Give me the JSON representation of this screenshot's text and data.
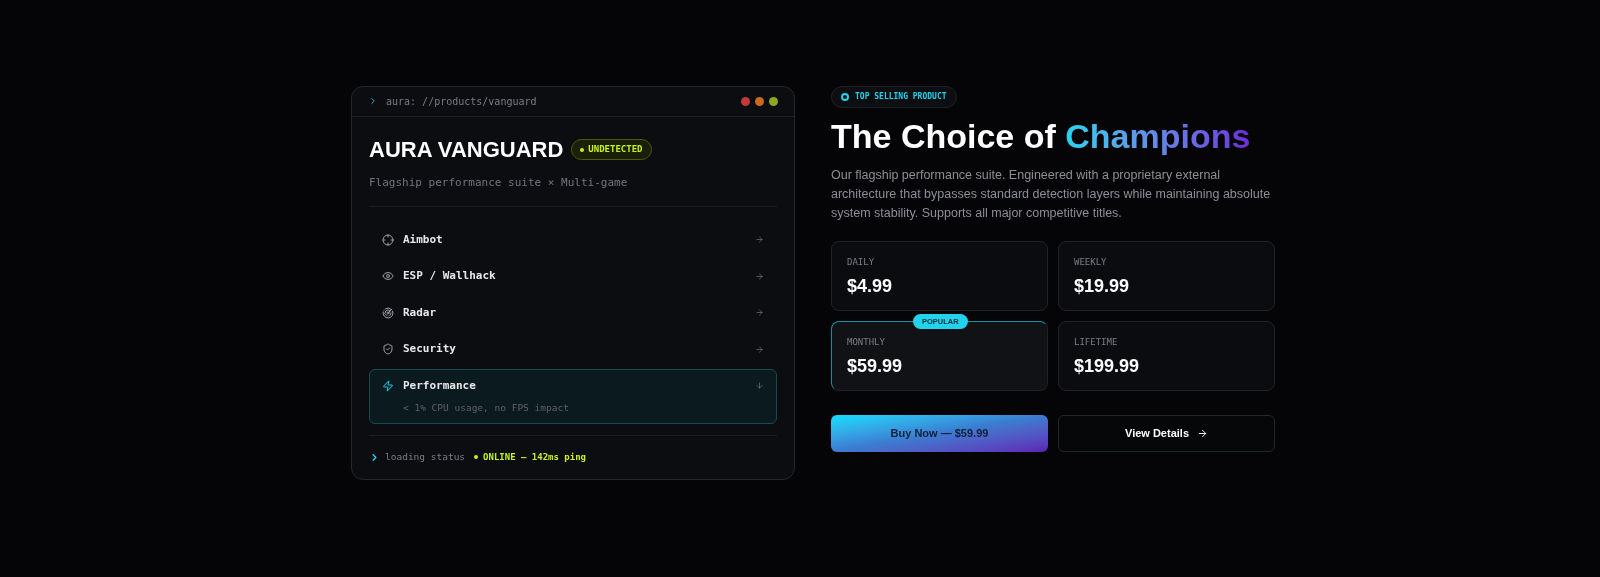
{
  "terminal": {
    "path": "aura: //products/vanguard"
  },
  "product": {
    "name": "AURA VANGUARD",
    "status": "UNDETECTED",
    "subtitle": "Flagship performance suite × Multi-game"
  },
  "features": [
    {
      "label": "Aimbot",
      "expanded": false
    },
    {
      "label": "ESP / Wallhack",
      "expanded": false
    },
    {
      "label": "Radar",
      "expanded": false
    },
    {
      "label": "Security",
      "expanded": false
    },
    {
      "label": "Performance",
      "expanded": true,
      "detail": "< 1% CPU usage, no FPS impact"
    }
  ],
  "status_line": {
    "label": "loading status",
    "value": "ONLINE — 142ms ping"
  },
  "badge": "TOP SELLING PRODUCT",
  "headline": {
    "text": "The Choice of",
    "highlight": "Champions"
  },
  "description": "Our flagship performance suite. Engineered with a proprietary external architecture that bypasses standard detection layers while maintaining absolute system stability. Supports all major competitive titles.",
  "plans": [
    {
      "period": "DAILY",
      "price": "$4.99",
      "selected": false
    },
    {
      "period": "WEEKLY",
      "price": "$19.99",
      "selected": false
    },
    {
      "period": "MONTHLY",
      "price": "$59.99",
      "selected": true,
      "tag": "POPULAR"
    },
    {
      "period": "LIFETIME",
      "price": "$199.99",
      "selected": false
    }
  ],
  "buttons": {
    "buy": "Buy Now — $59.99",
    "details": "View Details"
  }
}
